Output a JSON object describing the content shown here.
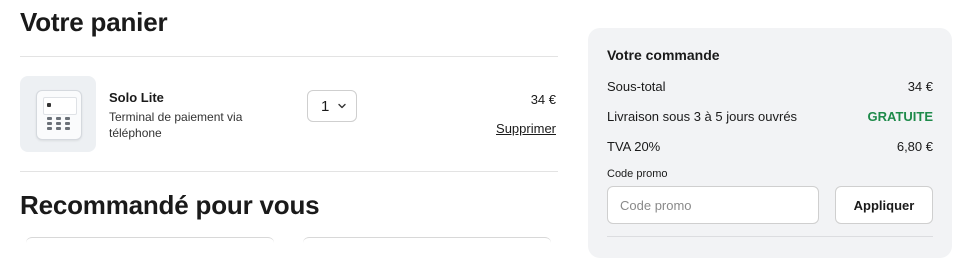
{
  "cart": {
    "title": "Votre panier",
    "item": {
      "name": "Solo Lite",
      "description": "Terminal de paiement via téléphone",
      "quantity": "1",
      "price": "34 €",
      "remove_label": "Supprimer",
      "image_icon": "card-terminal-icon"
    }
  },
  "recommended": {
    "title": "Recommandé pour vous"
  },
  "summary": {
    "title": "Votre commande",
    "subtotal_label": "Sous-total",
    "subtotal_value": "34 €",
    "shipping_label": "Livraison sous 3 à 5 jours ouvrés",
    "shipping_value": "GRATUITE",
    "tax_label": "TVA 20%",
    "tax_value": "6,80 €",
    "promo_label": "Code promo",
    "promo_placeholder": "Code promo",
    "apply_label": "Appliquer"
  },
  "colors": {
    "free_shipping": "#1e8a4a",
    "summary_background": "#f2f3f5"
  }
}
